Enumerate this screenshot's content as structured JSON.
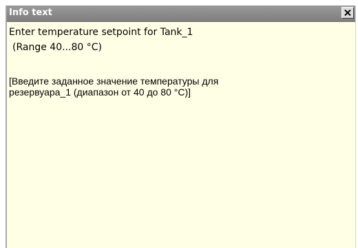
{
  "window": {
    "title": "Info text",
    "close_icon": "close-icon"
  },
  "content": {
    "english_line_1": "Enter temperature setpoint for Tank_1",
    "english_line_2": "(Range 40...80 °C)",
    "russian_line_1": "[Введите заданное значение температуры для",
    "russian_line_2": "резервуара_1 (диапазон от 40 до 80 °C)]"
  },
  "colors": {
    "titlebar": "#8c8c8c",
    "title_text": "#ffffff",
    "background": "#ffffe6",
    "text": "#000000"
  }
}
